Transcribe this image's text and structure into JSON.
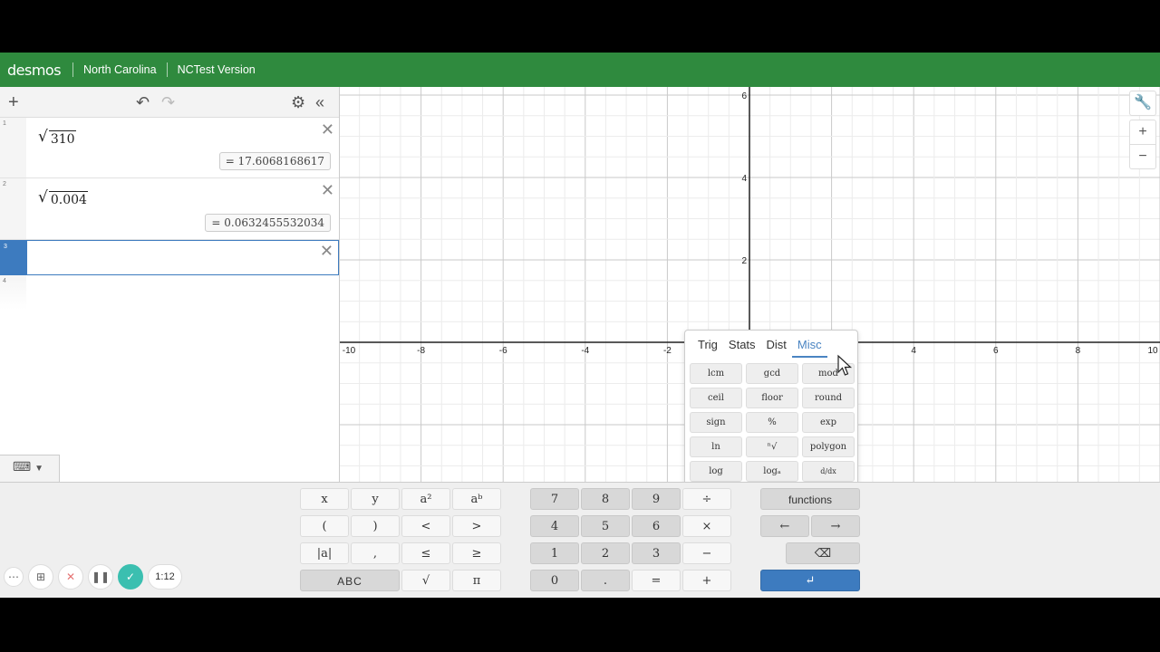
{
  "header": {
    "logo": "desmos",
    "state": "North Carolina",
    "version": "NCTest Version"
  },
  "expressions": [
    {
      "index": "1",
      "radicand": "310",
      "result": "= 17.6068168617"
    },
    {
      "index": "2",
      "radicand": "0.004",
      "result": "= 0.0632455532034"
    },
    {
      "index": "3",
      "radicand": "",
      "result": ""
    },
    {
      "index": "4"
    }
  ],
  "graph": {
    "x_ticks": [
      "-10",
      "-8",
      "-6",
      "-4",
      "-2",
      "4",
      "6",
      "8",
      "10"
    ],
    "y_ticks": [
      "6",
      "4",
      "2"
    ],
    "x_range": [
      -10,
      10
    ],
    "y_range": [
      -2,
      6.2
    ]
  },
  "functions_popup": {
    "tabs": [
      "Trig",
      "Stats",
      "Dist",
      "Misc"
    ],
    "active_tab": "Misc",
    "buttons": [
      "lcm",
      "gcd",
      "mod",
      "ceil",
      "floor",
      "round",
      "sign",
      "%",
      "exp",
      "ln",
      "ⁿ√",
      "polygon",
      "log",
      "logₐ",
      "d/dx",
      "∫",
      "∑",
      "∏"
    ]
  },
  "keypad": {
    "left": [
      "x",
      "y",
      "a²",
      "aᵇ",
      "(",
      ")",
      "<",
      ">",
      "|a|",
      ",",
      "≤",
      "≥",
      "ABC",
      "√",
      "π"
    ],
    "numbers": [
      "7",
      "8",
      "9",
      "÷",
      "4",
      "5",
      "6",
      "×",
      "1",
      "2",
      "3",
      "−",
      "0",
      ".",
      "=",
      "+"
    ],
    "functions_label": "functions",
    "left_arrow": "←",
    "right_arrow": "→",
    "backspace": "⌫",
    "enter": "↵"
  },
  "recorder": {
    "timer": "1:12"
  },
  "colors": {
    "header": "#2f8a3e",
    "active_tab": "#4a84c2",
    "enter": "#3d7bbf",
    "check": "#3bbfb0"
  }
}
